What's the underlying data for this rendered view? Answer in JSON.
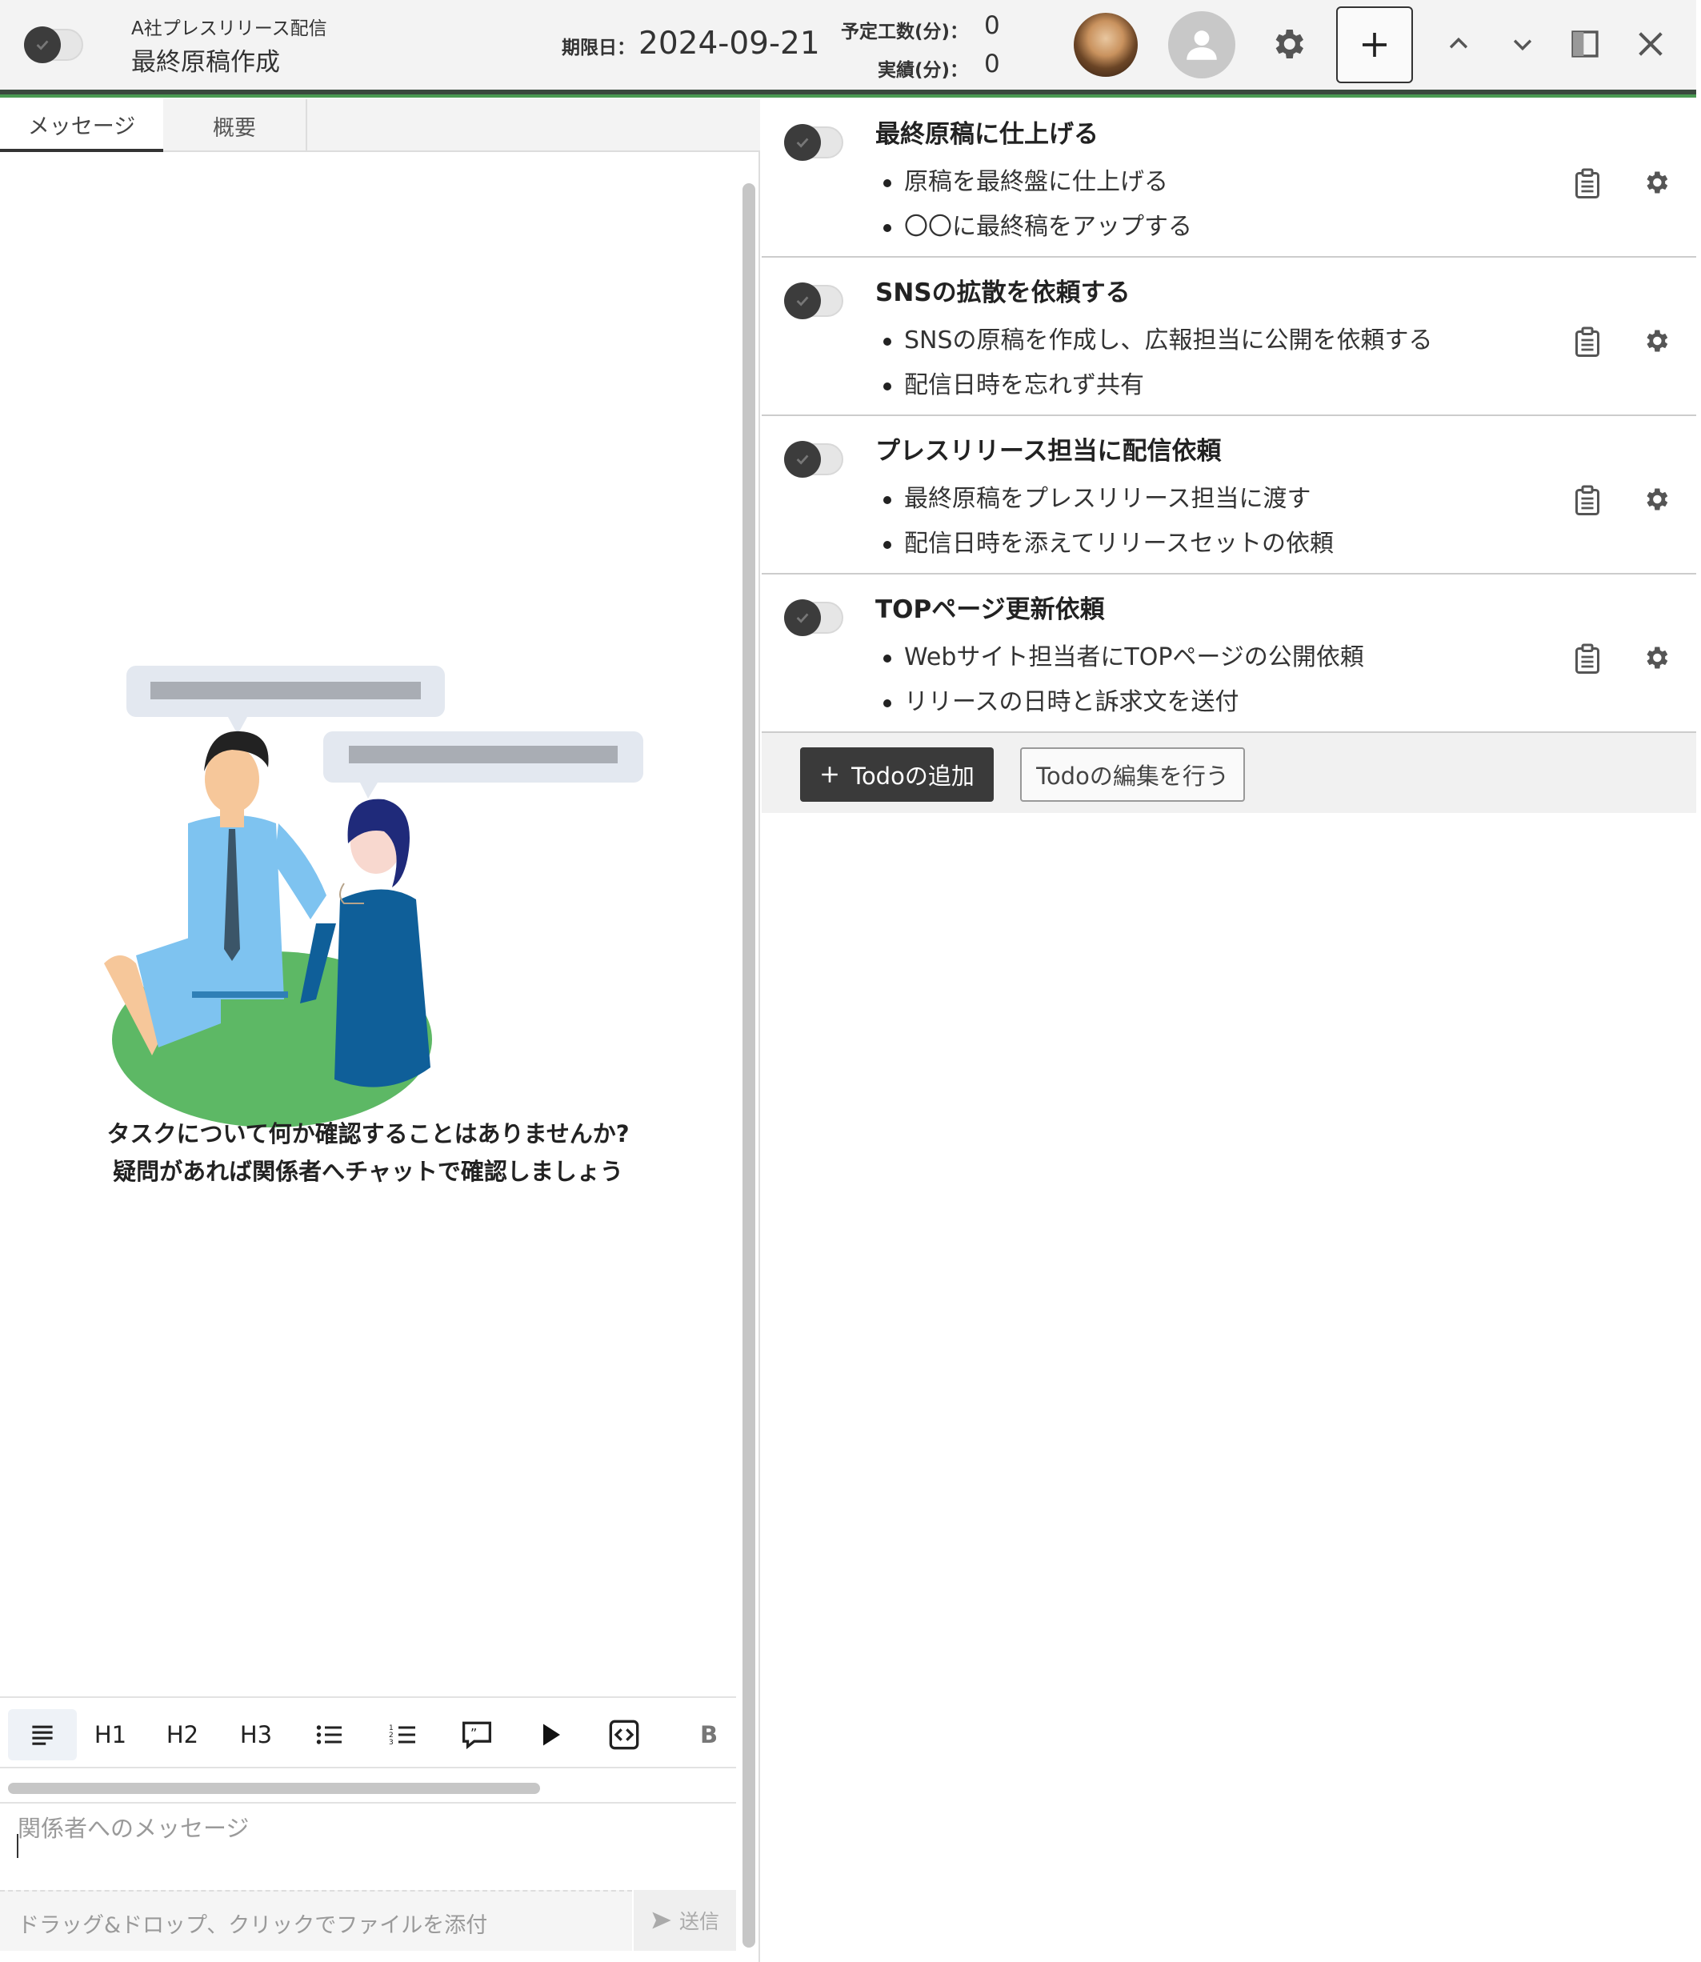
{
  "header": {
    "project": "A社プレスリリース配信",
    "title": "最終原稿作成",
    "due_label": "期限日：",
    "due_date": "2024-09-21",
    "planned_label": "予定工数(分)：",
    "planned_value": "0",
    "actual_label": "実績(分)：",
    "actual_value": "0"
  },
  "tabs": [
    {
      "label": "メッセージ",
      "active": true
    },
    {
      "label": "概要",
      "active": false
    }
  ],
  "chat": {
    "empty_line1": "タスクについて何か確認することはありませんか?",
    "empty_line2": "疑問があれば関係者へチャットで確認しましょう",
    "toolbar": [
      "H1",
      "H2",
      "H3",
      "B"
    ],
    "placeholder": "関係者へのメッセージ",
    "attach_text": "ドラッグ&ドロップ、クリックでファイルを添付",
    "send_label": "送信"
  },
  "todos": [
    {
      "title": "最終原稿に仕上げる",
      "items": [
        "原稿を最終盤に仕上げる",
        "〇〇に最終稿をアップする"
      ]
    },
    {
      "title": "SNSの拡散を依頼する",
      "items": [
        "SNSの原稿を作成し、広報担当に公開を依頼する",
        "配信日時を忘れず共有"
      ]
    },
    {
      "title": "プレスリリース担当に配信依頼",
      "items": [
        "最終原稿をプレスリリース担当に渡す",
        "配信日時を添えてリリースセットの依頼"
      ]
    },
    {
      "title": "TOPページ更新依頼",
      "items": [
        "Webサイト担当者にTOPページの公開依頼",
        "リリースの日時と訴求文を送付"
      ]
    }
  ],
  "actions": {
    "add_todo": "Todoの追加",
    "edit_todo": "Todoの編集を行う"
  },
  "colors": {
    "header_bg": "#f3f3f3",
    "accent_green": "#4a9a52",
    "dark_button": "#3a3a3a"
  }
}
